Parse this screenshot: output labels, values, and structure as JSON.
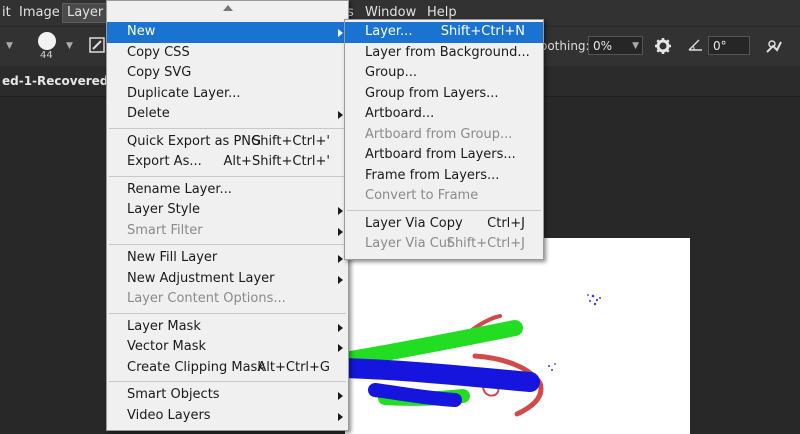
{
  "menubar": {
    "items": [
      {
        "label": "it"
      },
      {
        "label": "Image"
      },
      {
        "label": "Layer"
      },
      {
        "label": "s"
      },
      {
        "label": "Window"
      },
      {
        "label": "Help"
      }
    ]
  },
  "options": {
    "brush_size": "44",
    "smoothing_label": "oothing:",
    "smoothing_value": "0%",
    "angle_value": "0°"
  },
  "document": {
    "tab_title": "ed-1-Recovered @"
  },
  "layer_menu": {
    "items": [
      {
        "label": "New",
        "shortcut": "",
        "submenu": true,
        "disabled": false,
        "highlight": true
      },
      {
        "label": "Copy CSS",
        "shortcut": "",
        "submenu": false,
        "disabled": false
      },
      {
        "label": "Copy SVG",
        "shortcut": "",
        "submenu": false,
        "disabled": false
      },
      {
        "label": "Duplicate Layer...",
        "shortcut": "",
        "submenu": false,
        "disabled": false
      },
      {
        "label": "Delete",
        "shortcut": "",
        "submenu": true,
        "disabled": false
      },
      {
        "label": "Quick Export as PNG",
        "shortcut": "Shift+Ctrl+'",
        "submenu": false,
        "disabled": false
      },
      {
        "label": "Export As...",
        "shortcut": "Alt+Shift+Ctrl+'",
        "submenu": false,
        "disabled": false
      },
      {
        "label": "Rename Layer...",
        "shortcut": "",
        "submenu": false,
        "disabled": false
      },
      {
        "label": "Layer Style",
        "shortcut": "",
        "submenu": true,
        "disabled": false
      },
      {
        "label": "Smart Filter",
        "shortcut": "",
        "submenu": true,
        "disabled": true
      },
      {
        "label": "New Fill Layer",
        "shortcut": "",
        "submenu": true,
        "disabled": false
      },
      {
        "label": "New Adjustment Layer",
        "shortcut": "",
        "submenu": true,
        "disabled": false
      },
      {
        "label": "Layer Content Options...",
        "shortcut": "",
        "submenu": false,
        "disabled": true
      },
      {
        "label": "Layer Mask",
        "shortcut": "",
        "submenu": true,
        "disabled": false
      },
      {
        "label": "Vector Mask",
        "shortcut": "",
        "submenu": true,
        "disabled": false
      },
      {
        "label": "Create Clipping Mask",
        "shortcut": "Alt+Ctrl+G",
        "submenu": false,
        "disabled": false
      },
      {
        "label": "Smart Objects",
        "shortcut": "",
        "submenu": true,
        "disabled": false
      },
      {
        "label": "Video Layers",
        "shortcut": "",
        "submenu": true,
        "disabled": false
      }
    ]
  },
  "new_submenu": {
    "items": [
      {
        "label": "Layer...",
        "shortcut": "Shift+Ctrl+N",
        "disabled": false,
        "highlight": true
      },
      {
        "label": "Layer from Background...",
        "shortcut": "",
        "disabled": false
      },
      {
        "label": "Group...",
        "shortcut": "",
        "disabled": false
      },
      {
        "label": "Group from Layers...",
        "shortcut": "",
        "disabled": false
      },
      {
        "label": "Artboard...",
        "shortcut": "",
        "disabled": false
      },
      {
        "label": "Artboard from Group...",
        "shortcut": "",
        "disabled": true
      },
      {
        "label": "Artboard from Layers...",
        "shortcut": "",
        "disabled": false
      },
      {
        "label": "Frame from Layers...",
        "shortcut": "",
        "disabled": false
      },
      {
        "label": "Convert to Frame",
        "shortcut": "",
        "disabled": true
      },
      {
        "label": "Layer Via Copy",
        "shortcut": "Ctrl+J",
        "disabled": false
      },
      {
        "label": "Layer Via Cut",
        "shortcut": "Shift+Ctrl+J",
        "disabled": true
      }
    ]
  },
  "colors": {
    "highlight": "#1a73d1",
    "stroke_green": "#22dd22",
    "stroke_blue": "#1515dd",
    "stroke_red": "#d04a4a"
  }
}
